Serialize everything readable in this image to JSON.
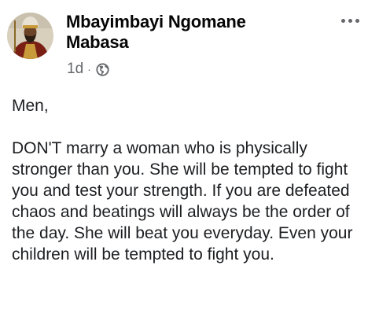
{
  "post": {
    "author_name": "Mbayimbayi Ngomane Mabasa",
    "timestamp": "1d",
    "separator": "·",
    "audience_icon": "globe-icon",
    "more_icon": "more-options-icon",
    "greeting": "Men,",
    "body": "DON'T marry a woman who is physically stronger than you. She will be tempted to fight you and test your strength. If you are defeated chaos and beatings will always be the order of the day. She will beat you everyday. Even your children will be tempted to fight you."
  },
  "colors": {
    "name": "#050505",
    "text": "#1c1e21",
    "secondary": "#65676b",
    "background": "#ffffff"
  }
}
